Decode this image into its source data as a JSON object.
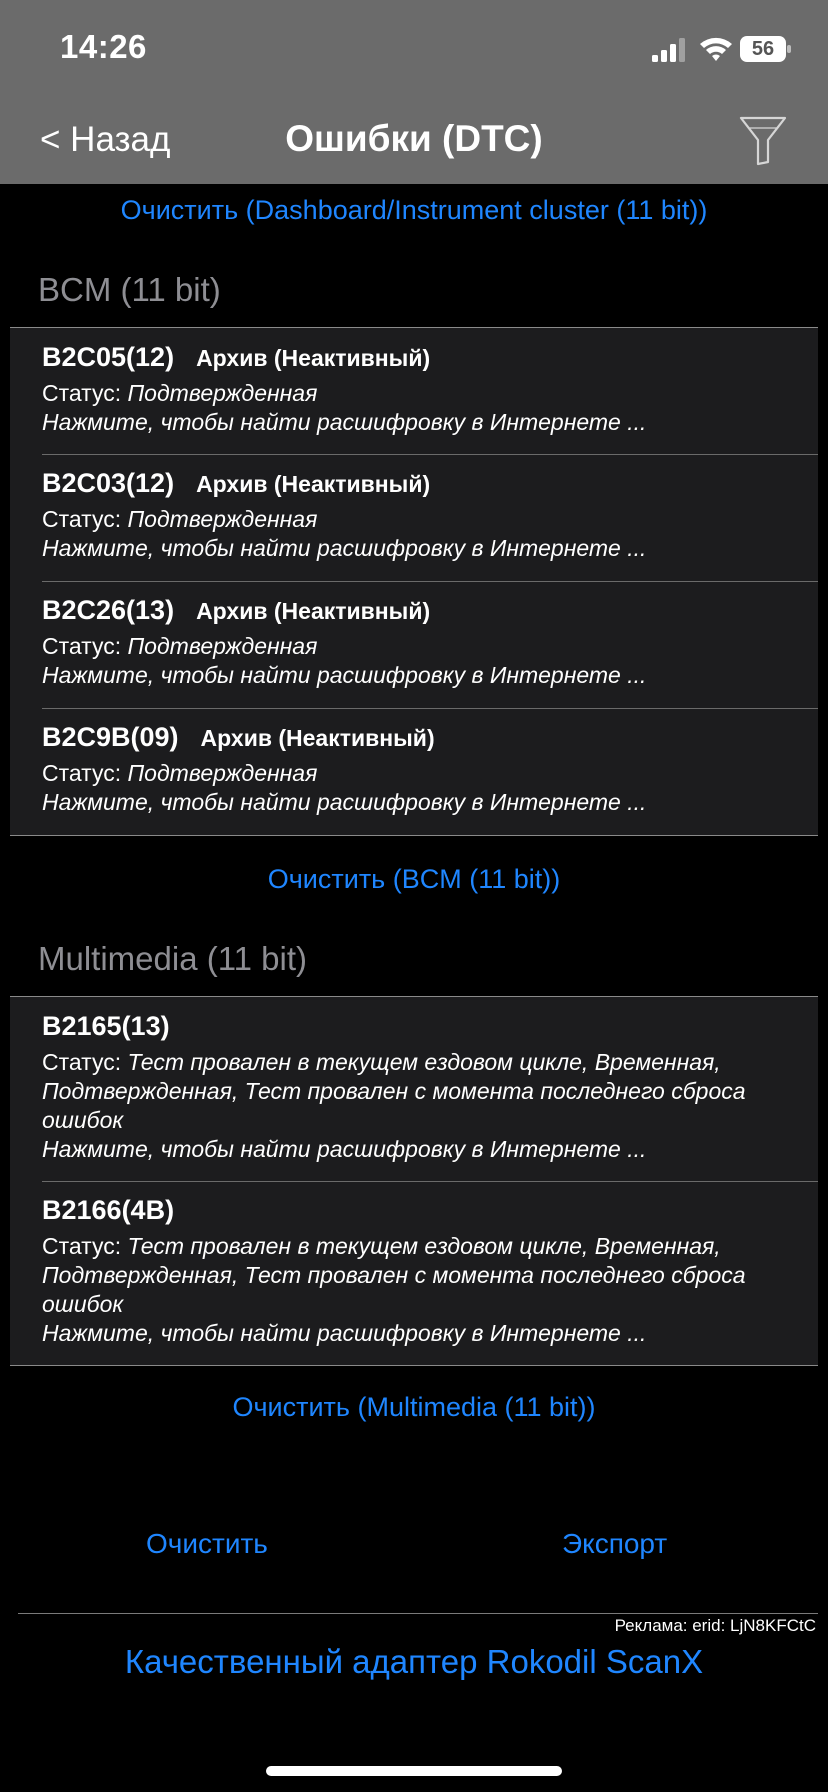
{
  "status_bar": {
    "time": "14:26",
    "battery": "56"
  },
  "nav": {
    "back_label": "< Назад",
    "title": "Ошибки (DTC)",
    "filter_icon": "filter-funnel-icon"
  },
  "top_clear": "Очистить (Dashboard/Instrument cluster (11 bit))",
  "sections": [
    {
      "header": "BCM (11 bit)",
      "clear_label": "Очистить (BCM (11 bit))",
      "items": [
        {
          "code": "B2C05(12)",
          "state": "Архив (Неактивный)",
          "status_label": "Статус: ",
          "status": "Подтвержденная",
          "hint": "Нажмите, чтобы найти расшифровку в Интернете ..."
        },
        {
          "code": "B2C03(12)",
          "state": "Архив (Неактивный)",
          "status_label": "Статус: ",
          "status": "Подтвержденная",
          "hint": "Нажмите, чтобы найти расшифровку в Интернете ..."
        },
        {
          "code": "B2C26(13)",
          "state": "Архив (Неактивный)",
          "status_label": "Статус: ",
          "status": "Подтвержденная",
          "hint": "Нажмите, чтобы найти расшифровку в Интернете ..."
        },
        {
          "code": "B2C9B(09)",
          "state": "Архив (Неактивный)",
          "status_label": "Статус: ",
          "status": "Подтвержденная",
          "hint": "Нажмите, чтобы найти расшифровку в Интернете ..."
        }
      ]
    },
    {
      "header": "Multimedia (11 bit)",
      "clear_label": "Очистить (Multimedia (11 bit))",
      "items": [
        {
          "code": "B2165(13)",
          "status_label": "Статус: ",
          "status": "Тест провален в текущем ездовом цикле, Временная, Подтвержденная, Тест провален с момента последнего сброса ошибок",
          "hint": "Нажмите, чтобы найти расшифровку в Интернете ..."
        },
        {
          "code": "B2166(4B)",
          "status_label": "Статус: ",
          "status": "Тест провален в текущем ездовом цикле, Временная, Подтвержденная, Тест провален с момента последнего сброса ошибок",
          "hint": "Нажмите, чтобы найти расшифровку в Интернете ..."
        }
      ]
    }
  ],
  "bottom": {
    "clear": "Очистить",
    "export": "Экспорт"
  },
  "ad": {
    "label": "Реклама: erid: LjN8KFCtC",
    "link": "Качественный адаптер Rokodil ScanX"
  }
}
